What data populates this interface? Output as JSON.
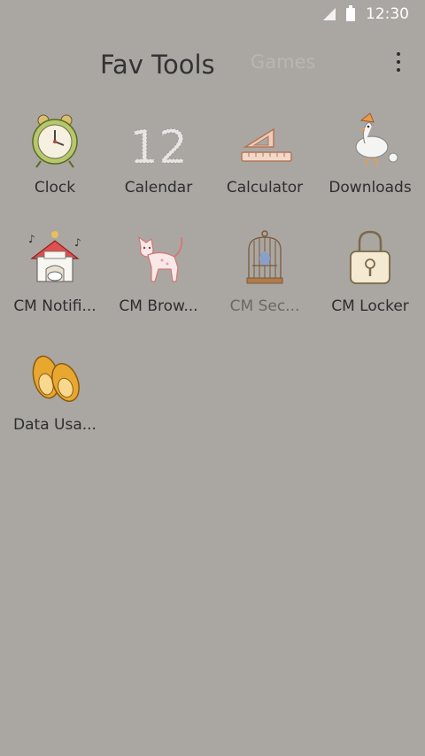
{
  "status": {
    "time": "12:30",
    "icons": [
      "signal-icon",
      "battery-icon"
    ]
  },
  "header": {
    "active_tab": "Fav Tools",
    "inactive_tab": "Games",
    "menu_icon": "overflow-menu-icon"
  },
  "apps": [
    {
      "label": "Clock",
      "icon": "alarm-clock-icon"
    },
    {
      "label": "Calendar",
      "icon": "calendar-twelve-icon"
    },
    {
      "label": "Calculator",
      "icon": "ruler-triangle-icon"
    },
    {
      "label": "Downloads",
      "icon": "goose-icon"
    },
    {
      "label": "CM Notifi...",
      "icon": "doghouse-icon"
    },
    {
      "label": "CM Brow...",
      "icon": "cat-icon"
    },
    {
      "label": "CM Sec...",
      "icon": "birdcage-icon"
    },
    {
      "label": "CM Locker",
      "icon": "padlock-icon"
    },
    {
      "label": "Data Usa...",
      "icon": "slippers-icon"
    }
  ],
  "colors": {
    "background": "#aaa7a2",
    "status_text": "#ffffff",
    "active_tab": "#333333",
    "inactive_tab": "#b9b5b0"
  }
}
